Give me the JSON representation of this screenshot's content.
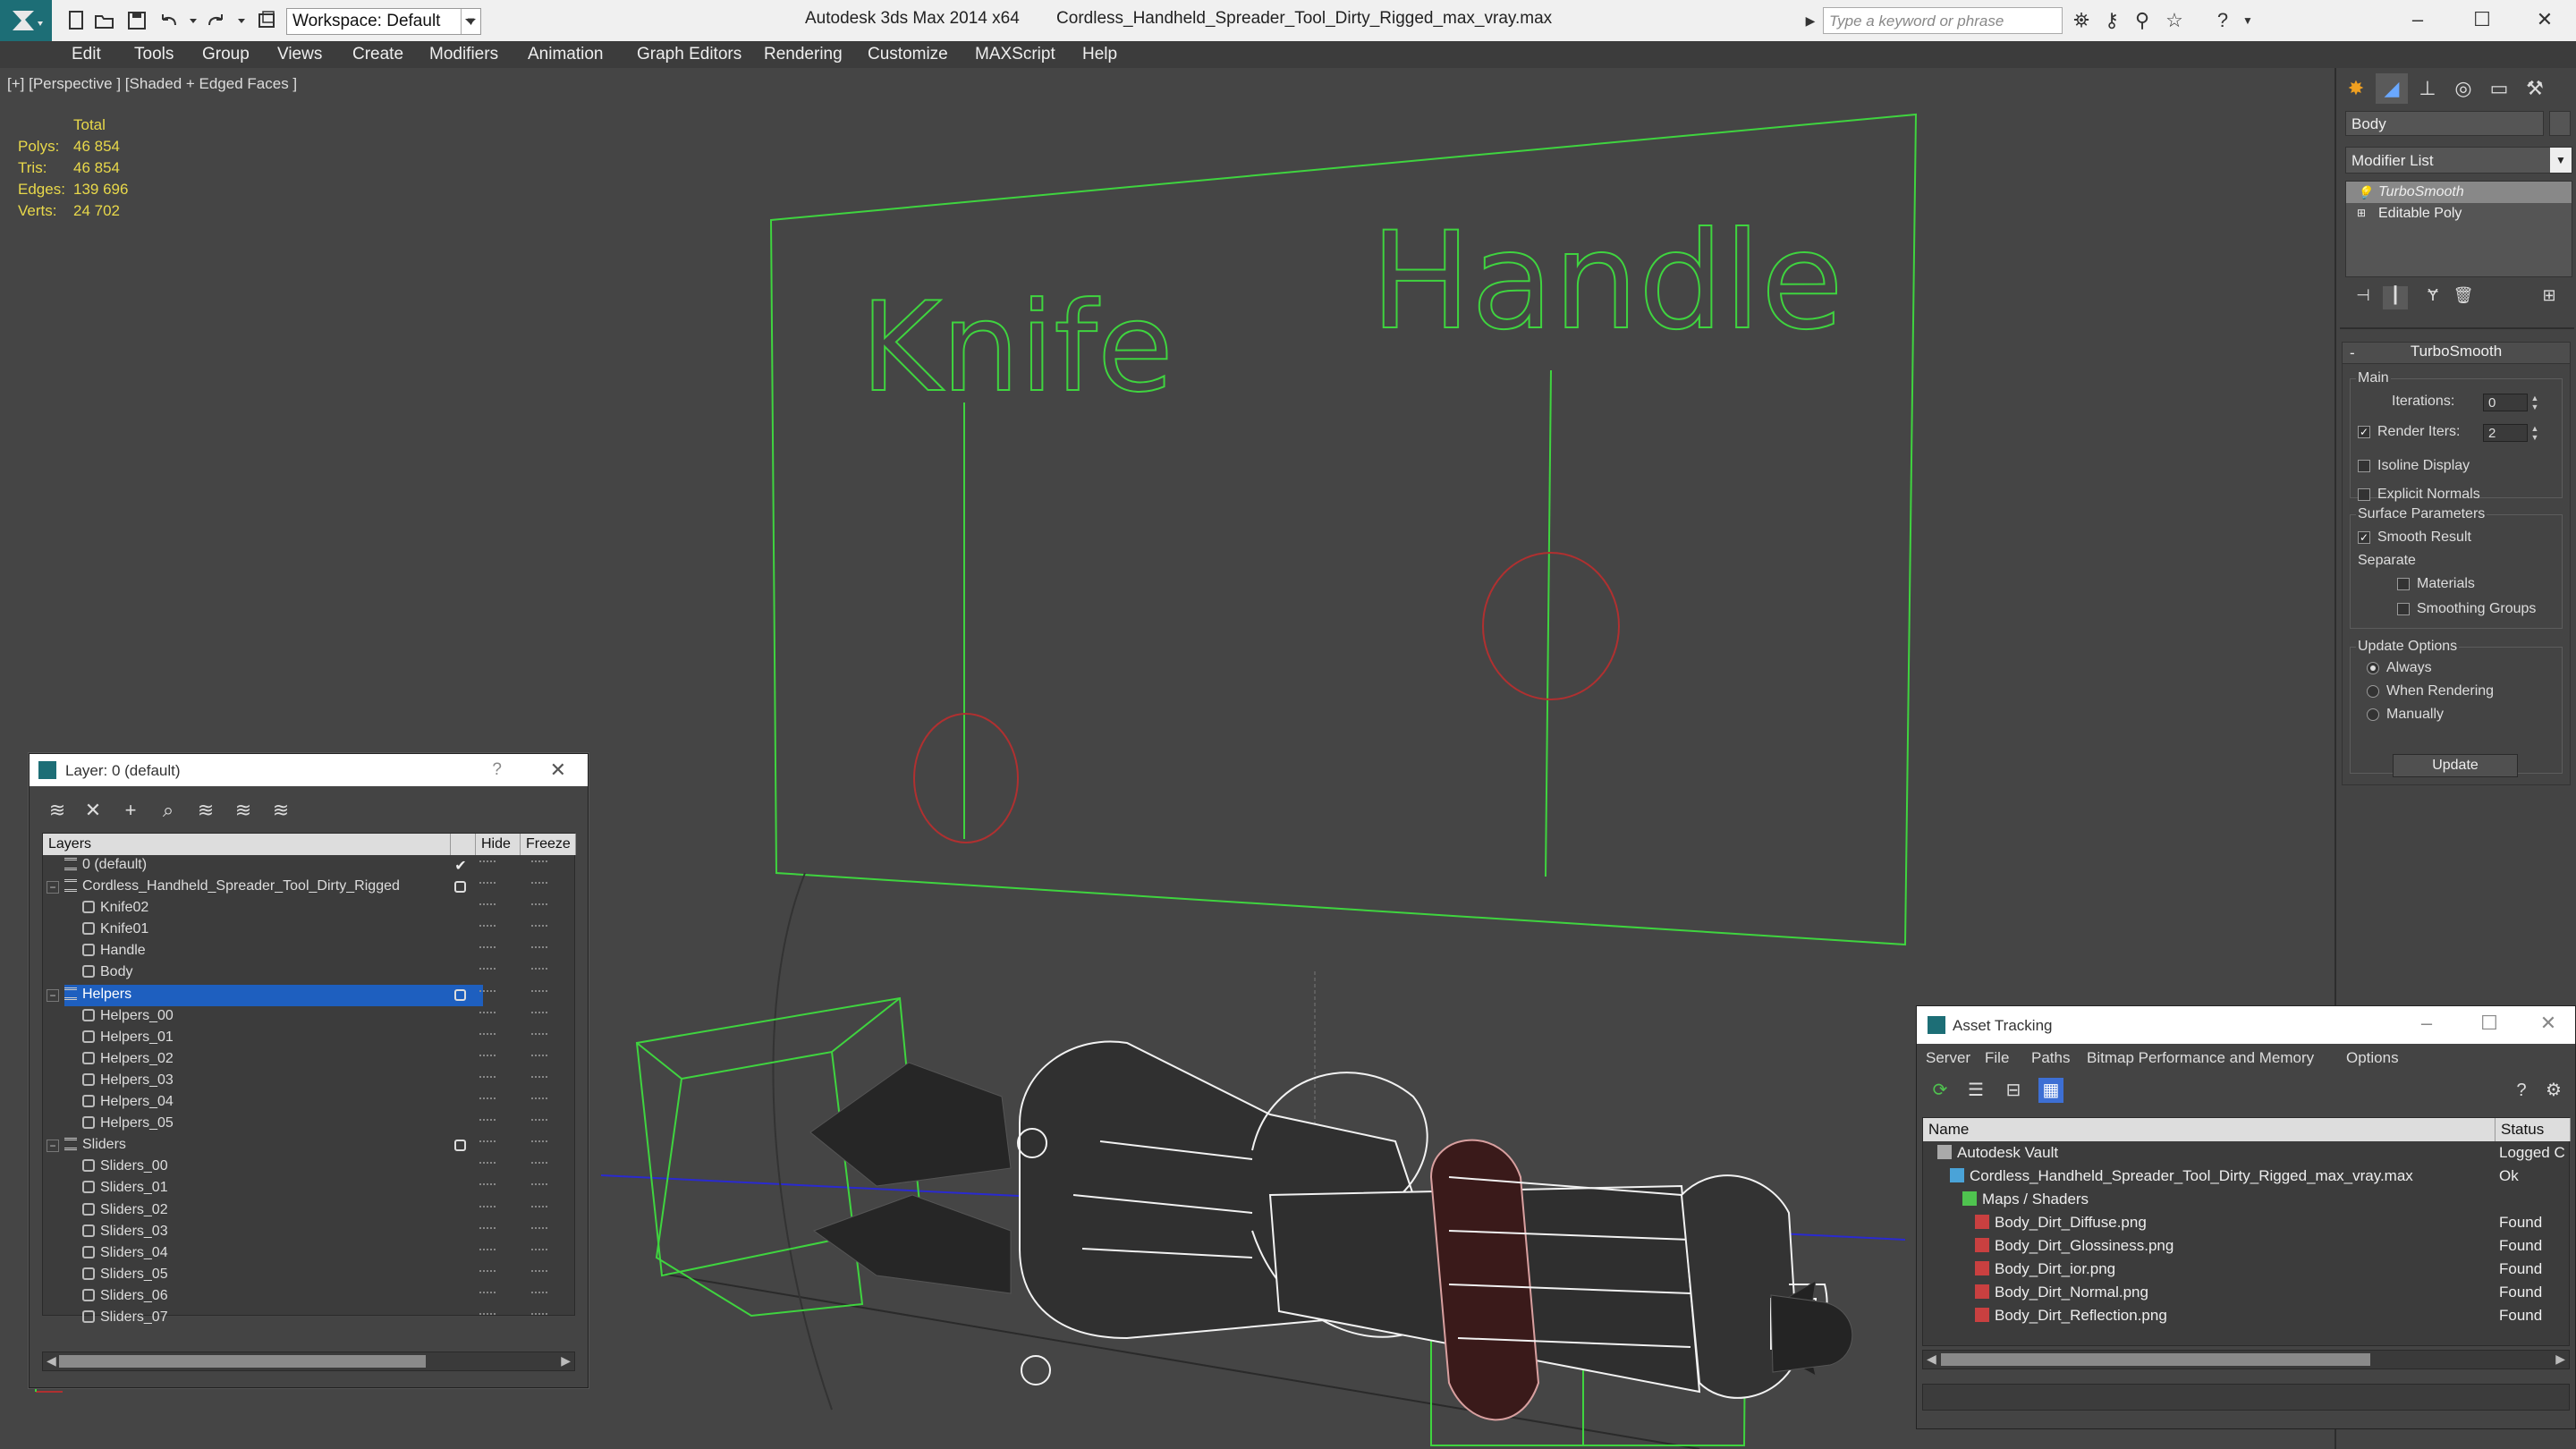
{
  "titlebar": {
    "app_title": "Autodesk 3ds Max 2014 x64",
    "file_title": "Cordless_Handheld_Spreader_Tool_Dirty_Rigged_max_vray.max",
    "workspace": "Workspace: Default",
    "search_placeholder": "Type a keyword or phrase"
  },
  "menu": [
    "Edit",
    "Tools",
    "Group",
    "Views",
    "Create",
    "Modifiers",
    "Animation",
    "Graph Editors",
    "Rendering",
    "Customize",
    "MAXScript",
    "Help"
  ],
  "viewport": {
    "label": "[+] [Perspective ] [Shaded + Edged Faces ]",
    "stats": {
      "header": "Total",
      "rows": [
        {
          "label": "Polys:",
          "value": "46 854"
        },
        {
          "label": "Tris:",
          "value": "46 854"
        },
        {
          "label": "Edges:",
          "value": "139 696"
        },
        {
          "label": "Verts:",
          "value": "24 702"
        }
      ]
    },
    "text_knife": "Knife",
    "text_handle": "Handle",
    "colors": {
      "wire_green": "#3fd43f",
      "wire_white": "#f2f2f2",
      "circle_red": "#b03030",
      "axis_blue": "#2a2ad0"
    }
  },
  "command_panel": {
    "object_name": "Body",
    "modifier_list": "Modifier List",
    "stack": [
      {
        "label": "TurboSmooth",
        "selected": true
      },
      {
        "label": "Editable Poly",
        "selected": false
      }
    ],
    "rollout_title": "TurboSmooth",
    "main_group": "Main",
    "iterations_label": "Iterations:",
    "iterations_value": "0",
    "render_iters_label": "Render Iters:",
    "render_iters_value": "2",
    "isoline_label": "Isoline Display",
    "explicit_normals_label": "Explicit Normals",
    "surface_group": "Surface Parameters",
    "smooth_result_label": "Smooth Result",
    "separate_label": "Separate",
    "materials_label": "Materials",
    "smoothing_groups_label": "Smoothing Groups",
    "update_group": "Update Options",
    "always_label": "Always",
    "when_rendering_label": "When Rendering",
    "manually_label": "Manually",
    "update_button": "Update"
  },
  "layer_dialog": {
    "title": "Layer: 0 (default)",
    "help": "?",
    "col_layers": "Layers",
    "col_hide": "Hide",
    "col_freeze": "Freeze",
    "rows": [
      {
        "name": "0 (default)",
        "type": "layer",
        "child": false,
        "current": true
      },
      {
        "name": "Cordless_Handheld_Spreader_Tool_Dirty_Rigged",
        "type": "layer",
        "child": false,
        "toggle": "−",
        "box": true
      },
      {
        "name": "Knife02",
        "type": "obj",
        "child": true
      },
      {
        "name": "Knife01",
        "type": "obj",
        "child": true
      },
      {
        "name": "Handle",
        "type": "obj",
        "child": true
      },
      {
        "name": "Body",
        "type": "obj",
        "child": true
      },
      {
        "name": "Helpers",
        "type": "layer",
        "child": false,
        "toggle": "−",
        "box": true,
        "selected": true
      },
      {
        "name": "Helpers_00",
        "type": "obj",
        "child": true
      },
      {
        "name": "Helpers_01",
        "type": "obj",
        "child": true
      },
      {
        "name": "Helpers_02",
        "type": "obj",
        "child": true
      },
      {
        "name": "Helpers_03",
        "type": "obj",
        "child": true
      },
      {
        "name": "Helpers_04",
        "type": "obj",
        "child": true
      },
      {
        "name": "Helpers_05",
        "type": "obj",
        "child": true
      },
      {
        "name": "Sliders",
        "type": "layer",
        "child": false,
        "toggle": "−",
        "box": true
      },
      {
        "name": "Sliders_00",
        "type": "obj",
        "child": true
      },
      {
        "name": "Sliders_01",
        "type": "obj",
        "child": true
      },
      {
        "name": "Sliders_02",
        "type": "obj",
        "child": true
      },
      {
        "name": "Sliders_03",
        "type": "obj",
        "child": true
      },
      {
        "name": "Sliders_04",
        "type": "obj",
        "child": true
      },
      {
        "name": "Sliders_05",
        "type": "obj",
        "child": true
      },
      {
        "name": "Sliders_06",
        "type": "obj",
        "child": true
      },
      {
        "name": "Sliders_07",
        "type": "obj",
        "child": true
      }
    ]
  },
  "asset_dialog": {
    "title": "Asset Tracking",
    "menu": [
      "Server",
      "File",
      "Paths",
      "Bitmap Performance and Memory",
      "Options"
    ],
    "col_name": "Name",
    "col_status": "Status",
    "rows": [
      {
        "name": "Autodesk Vault",
        "status": "Logged C",
        "indent": 0,
        "icon": "vault"
      },
      {
        "name": "Cordless_Handheld_Spreader_Tool_Dirty_Rigged_max_vray.max",
        "status": "Ok",
        "indent": 1,
        "icon": "max"
      },
      {
        "name": "Maps / Shaders",
        "status": "",
        "indent": 2,
        "icon": "folder"
      },
      {
        "name": "Body_Dirt_Diffuse.png",
        "status": "Found",
        "indent": 3,
        "icon": "png"
      },
      {
        "name": "Body_Dirt_Glossiness.png",
        "status": "Found",
        "indent": 3,
        "icon": "png"
      },
      {
        "name": "Body_Dirt_ior.png",
        "status": "Found",
        "indent": 3,
        "icon": "png"
      },
      {
        "name": "Body_Dirt_Normal.png",
        "status": "Found",
        "indent": 3,
        "icon": "png"
      },
      {
        "name": "Body_Dirt_Reflection.png",
        "status": "Found",
        "indent": 3,
        "icon": "png"
      }
    ]
  }
}
